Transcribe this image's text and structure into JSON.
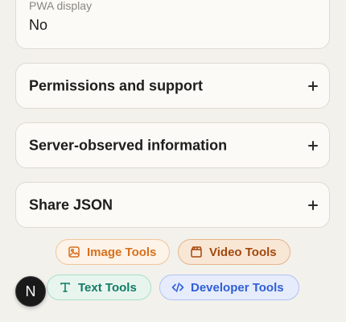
{
  "display_card": {
    "label": "PWA display",
    "value": "No"
  },
  "accordions": [
    {
      "title": "Permissions and support",
      "icon": "plus-icon"
    },
    {
      "title": "Server-observed information",
      "icon": "plus-icon"
    },
    {
      "title": "Share JSON",
      "icon": "plus-icon"
    }
  ],
  "tool_links": [
    {
      "label": "Image Tools",
      "icon": "image-icon",
      "color": "#d9701c"
    },
    {
      "label": "Video Tools",
      "icon": "video-icon",
      "color": "#a3480d"
    },
    {
      "label": "Text Tools",
      "icon": "text-icon",
      "color": "#137c64"
    },
    {
      "label": "Developer Tools",
      "icon": "code-icon",
      "color": "#2f5fd7"
    }
  ],
  "avatar": {
    "initial": "N"
  }
}
